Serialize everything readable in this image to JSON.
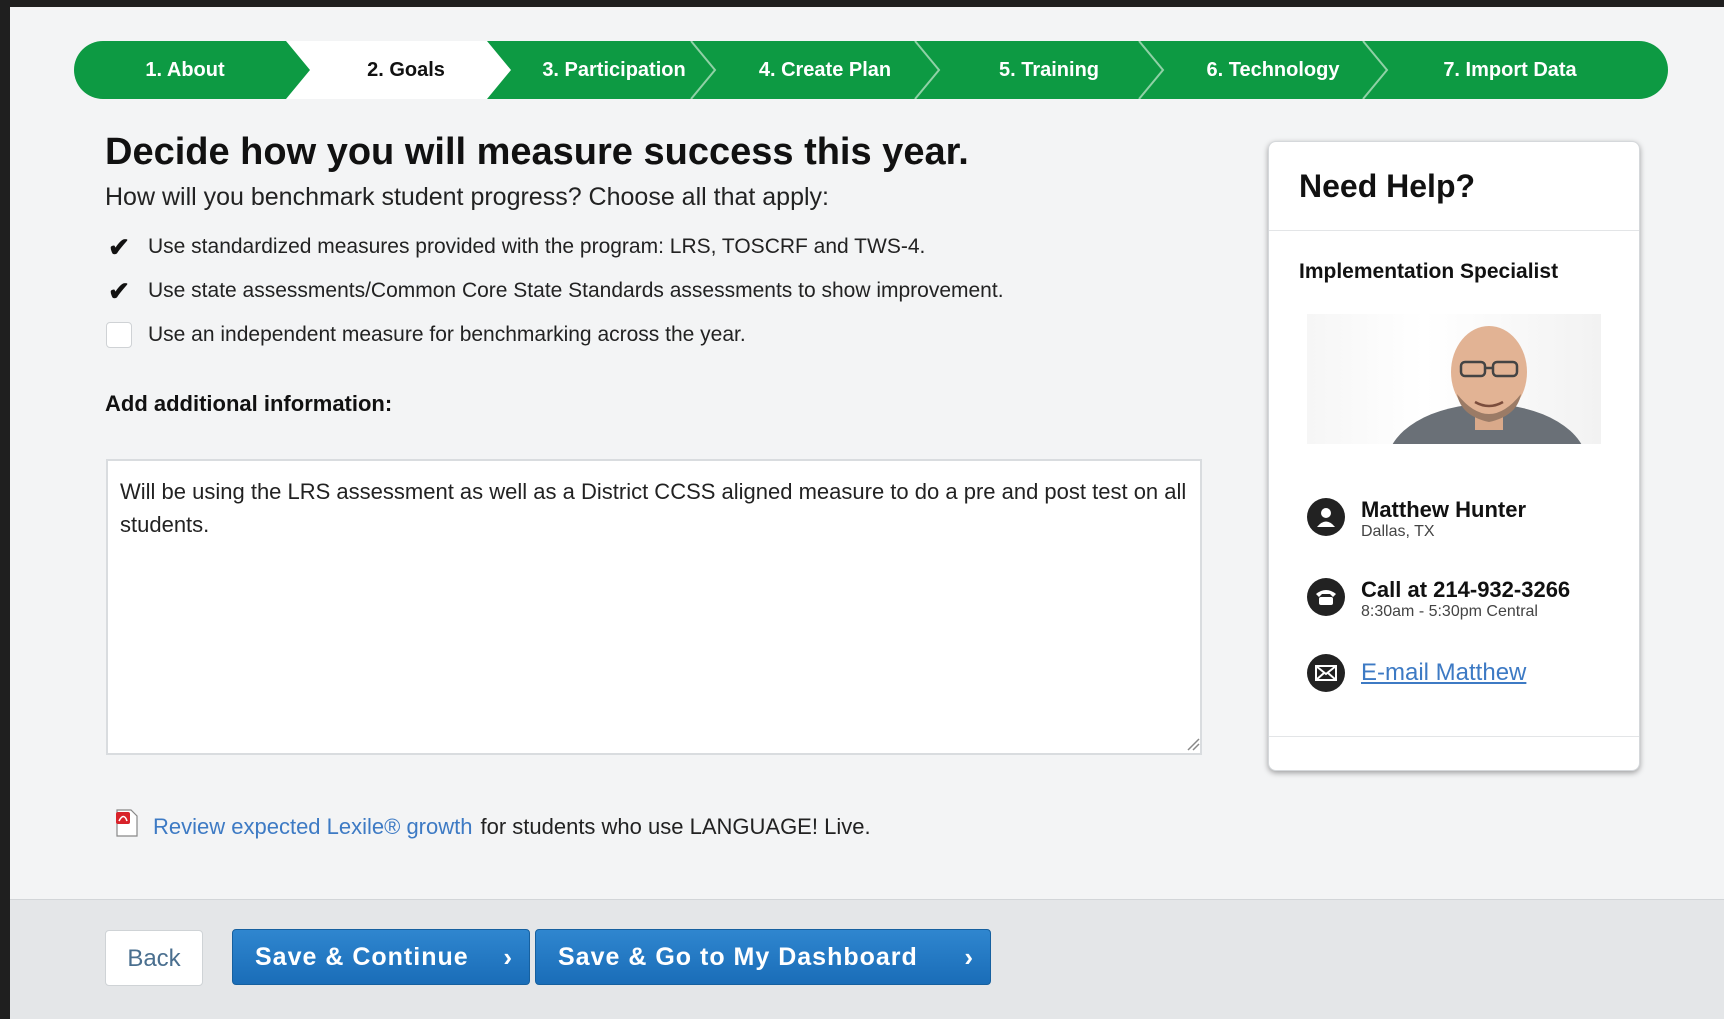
{
  "steps": [
    {
      "label": "1. About"
    },
    {
      "label": "2. Goals"
    },
    {
      "label": "3. Participation"
    },
    {
      "label": "4. Create Plan"
    },
    {
      "label": "5. Training"
    },
    {
      "label": "6. Technology"
    },
    {
      "label": "7. Import Data"
    }
  ],
  "active_step": 2,
  "colors": {
    "step_green": "#0d9a43",
    "link_blue": "#3d7ac4",
    "button_blue": "#1f75c1"
  },
  "main": {
    "heading": "Decide how you will measure success this year.",
    "subheading": "How will you benchmark student progress? Choose all that apply:",
    "options": [
      {
        "label": "Use standardized measures provided with the program: LRS, TOSCRF and TWS-4.",
        "checked": true
      },
      {
        "label": "Use state assessments/Common Core State Standards assessments to show improvement.",
        "checked": true
      },
      {
        "label": "Use an independent measure for benchmarking across the year.",
        "checked": false
      }
    ],
    "additional_label": "Add additional information:",
    "additional_text": "Will be using the LRS assessment as well as a District CCSS aligned measure to do a pre and post test on all students.",
    "review_link": "Review expected Lexile® growth",
    "review_rest": "for students who use LANGUAGE! Live.",
    "pdf_icon": "pdf-icon"
  },
  "help": {
    "title": "Need Help?",
    "role": "Implementation Specialist",
    "name": "Matthew Hunter",
    "location": "Dallas, TX",
    "call_prefix": "Call at",
    "phone": "214-932-3266",
    "hours": "8:30am - 5:30pm Central",
    "email_label": "E-mail Matthew",
    "icons": [
      "person-icon",
      "phone-icon",
      "envelope-icon"
    ]
  },
  "footer": {
    "back_label": "Back",
    "save_continue_label": "Save & Continue",
    "save_dashboard_label": "Save & Go to My Dashboard",
    "chevron": "›"
  }
}
